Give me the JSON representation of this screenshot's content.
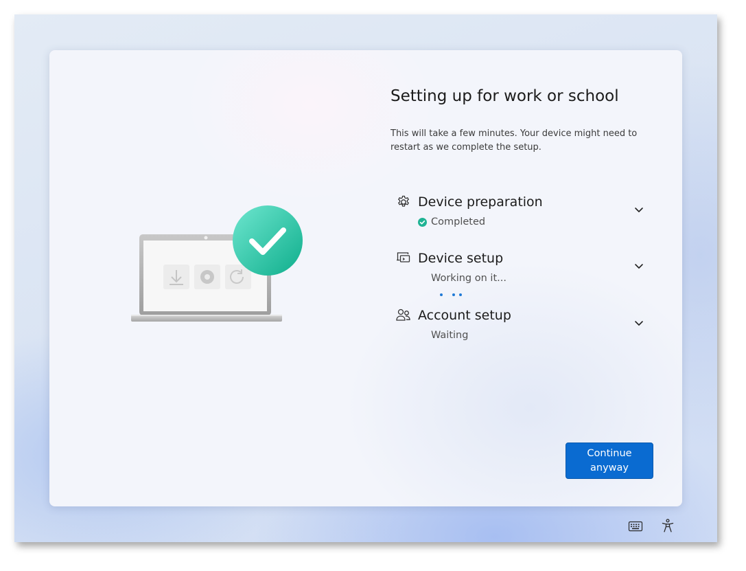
{
  "page": {
    "title": "Setting up for work or school",
    "subtitle": "This will take a few minutes. Your device might need to restart as we complete the setup."
  },
  "steps": [
    {
      "title": "Device preparation",
      "status": "Completed",
      "state": "completed",
      "icon": "gear-icon"
    },
    {
      "title": "Device setup",
      "status": "Working on it...",
      "state": "in-progress",
      "icon": "device-setup-icon"
    },
    {
      "title": "Account setup",
      "status": "Waiting",
      "state": "waiting",
      "icon": "people-icon"
    }
  ],
  "buttons": {
    "continue_label": "Continue anyway"
  },
  "taskbar": {
    "icons": [
      "keyboard-icon",
      "accessibility-icon"
    ]
  },
  "colors": {
    "accent": "#0a6bd1",
    "success": "#1fb394",
    "progress_dots": "#1f7ad6"
  }
}
